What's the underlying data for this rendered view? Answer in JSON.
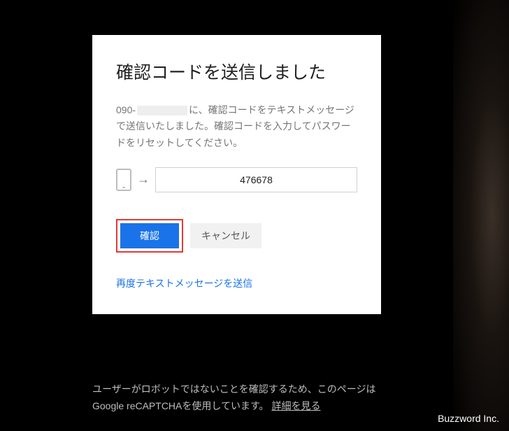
{
  "card": {
    "title": "確認コードを送信しました",
    "phone_prefix": "090-",
    "description_suffix": "に、確認コードをテキストメッセージで送信いたしました。確認コードを入力してパスワードをリセットしてください。",
    "code_value": "476678",
    "confirm_label": "確認",
    "cancel_label": "キャンセル",
    "resend_label": "再度テキストメッセージを送信"
  },
  "footer": {
    "recaptcha_text": "ユーザーがロボットではないことを確認するため、このページはGoogle reCAPTCHAを使用しています。 ",
    "detail_label": "詳細を見る"
  },
  "watermark": "Buzzword Inc."
}
